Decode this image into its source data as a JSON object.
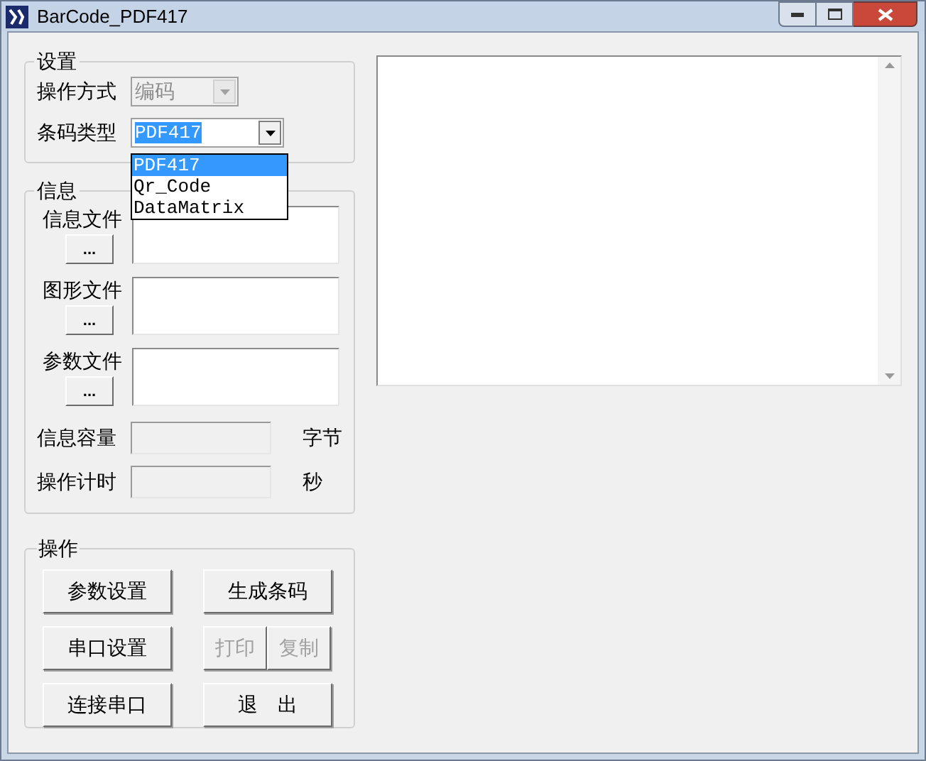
{
  "window": {
    "title": "BarCode_PDF417"
  },
  "settings": {
    "title": "设置",
    "fields": [
      {
        "label": "操作方式",
        "value": "编码",
        "disabled": true
      },
      {
        "label": "条码类型",
        "value": "PDF417",
        "disabled": false,
        "open": true
      }
    ]
  },
  "dropdown": {
    "options": [
      {
        "label": "PDF417",
        "selected": true
      },
      {
        "label": "Qr_Code",
        "selected": false
      },
      {
        "label": "DataMatrix",
        "selected": false
      }
    ]
  },
  "info": {
    "title": "信息",
    "files": [
      {
        "label": "信息文件",
        "button": "..."
      },
      {
        "label": "图形文件",
        "button": "..."
      },
      {
        "label": "参数文件",
        "button": "..."
      }
    ],
    "readouts": [
      {
        "label": "信息容量",
        "unit": "字节"
      },
      {
        "label": "操作计时",
        "unit": "秒"
      }
    ]
  },
  "actions": {
    "title": "操作",
    "rows": [
      {
        "left": {
          "label": "参数设置",
          "disabled": false
        },
        "right": [
          {
            "label": "生成条码",
            "disabled": false
          }
        ]
      },
      {
        "left": {
          "label": "串口设置",
          "disabled": false
        },
        "right": [
          {
            "label": "打印",
            "disabled": true
          },
          {
            "label": "复制",
            "disabled": true
          }
        ]
      },
      {
        "left": {
          "label": "连接串口",
          "disabled": false
        },
        "right": [
          {
            "label": "退　出",
            "disabled": false
          }
        ]
      }
    ]
  }
}
